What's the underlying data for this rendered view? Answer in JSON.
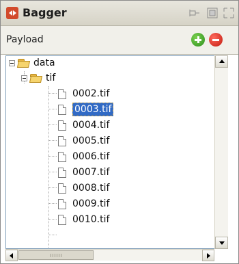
{
  "header": {
    "title": "Bagger"
  },
  "payload": {
    "label": "Payload",
    "add_label": "+",
    "remove_label": "−"
  },
  "tree": {
    "root": {
      "label": "data"
    },
    "child": {
      "label": "tif"
    },
    "files": [
      {
        "label": "0002.tif"
      },
      {
        "label": "0003.tif"
      },
      {
        "label": "0004.tif"
      },
      {
        "label": "0005.tif"
      },
      {
        "label": "0006.tif"
      },
      {
        "label": "0007.tif"
      },
      {
        "label": "0008.tif"
      },
      {
        "label": "0009.tif"
      },
      {
        "label": "0010.tif"
      }
    ],
    "selected_file": "0003.tif"
  },
  "colors": {
    "selection": "#316ac5",
    "add": "#3aa31f",
    "remove": "#d12216",
    "app_icon": "#d24a2c"
  },
  "icons": [
    "bagger-app-icon",
    "pin-icon",
    "restore-icon",
    "maximize-icon",
    "add-icon",
    "remove-icon",
    "folder-icon",
    "file-icon"
  ]
}
